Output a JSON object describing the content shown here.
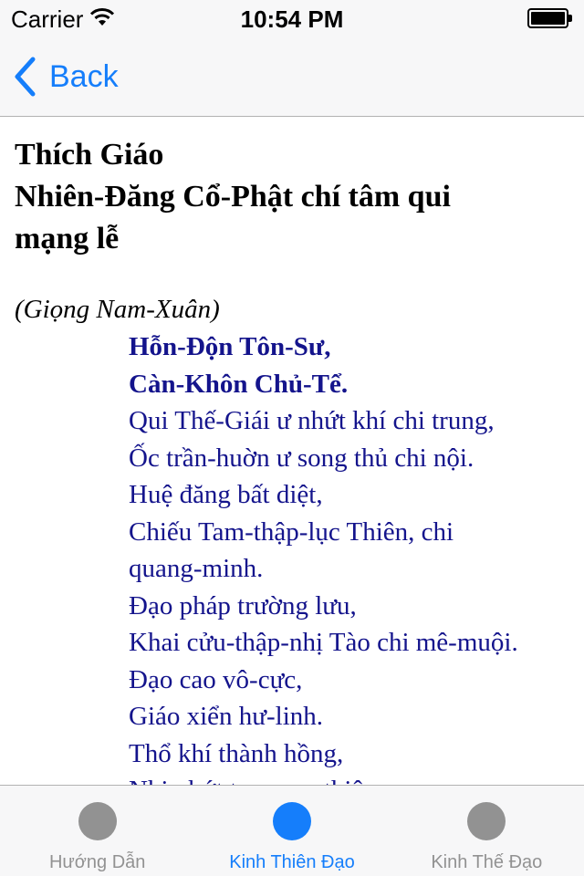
{
  "status_bar": {
    "carrier": "Carrier",
    "time": "10:54 PM",
    "wifi_icon": "wifi-icon",
    "battery_icon": "battery-full-icon",
    "battery_level": 1.0
  },
  "nav_bar": {
    "back_label": "Back",
    "back_icon": "chevron-left-icon"
  },
  "content": {
    "title_lines": [
      "Thích Giáo",
      "Nhiên-Đăng Cổ-Phật chí tâm qui",
      "mạng lễ"
    ],
    "subtitle": "(Giọng Nam-Xuân)",
    "verse_lines": [
      "Hỗn-Độn Tôn-Sư,",
      "Càn-Khôn Chủ-Tể.",
      "Qui Thế-Giái ư nhứt khí chi trung,",
      "Ốc trần-huờn ư song thủ chi nội.",
      "Huệ đăng bất diệt,",
      "Chiếu Tam-thập-lục Thiên, chi",
      "quang-minh.",
      "Đạo pháp trường lưu,",
      "Khai cửu-thập-nhị Tào chi mê-muội.",
      "Đạo cao vô-cực,",
      "Giáo xiển hư-linh.",
      "Thổ khí thành hồng,",
      "Nhi nhứt tru xang thiên,"
    ]
  },
  "tab_bar": {
    "tabs": [
      {
        "label": "Hướng Dẫn",
        "icon": "circle-icon",
        "active": false
      },
      {
        "label": "Kinh Thiên Đạo",
        "icon": "circle-icon",
        "active": true
      },
      {
        "label": "Kinh Thế Đạo",
        "icon": "circle-icon",
        "active": false
      }
    ]
  },
  "colors": {
    "accent": "#157efb",
    "verse_text": "#14148c",
    "inactive_tab": "#929292",
    "bar_background": "#f7f7f8"
  }
}
